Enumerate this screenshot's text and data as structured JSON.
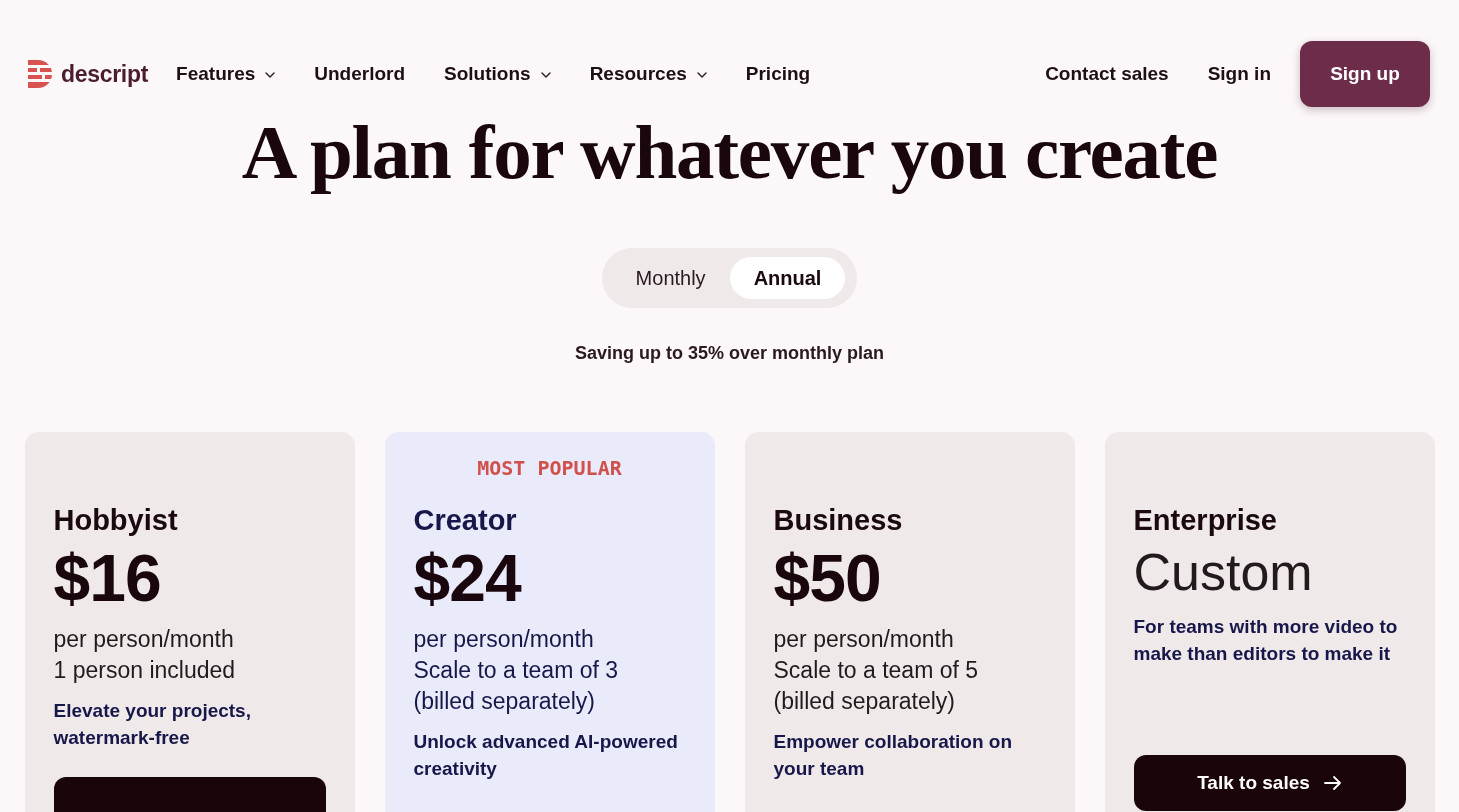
{
  "nav": {
    "logo": {
      "wordmark": "descript"
    },
    "links": [
      {
        "label": "Features",
        "has_menu": true
      },
      {
        "label": "Underlord",
        "has_menu": false
      },
      {
        "label": "Solutions",
        "has_menu": true
      },
      {
        "label": "Resources",
        "has_menu": true
      },
      {
        "label": "Pricing",
        "has_menu": false
      }
    ],
    "actions": [
      {
        "label": "Contact sales",
        "kind": "link"
      },
      {
        "label": "Sign in",
        "kind": "link"
      },
      {
        "label": "Sign up",
        "kind": "primary"
      }
    ]
  },
  "heading": "A plan for whatever you create",
  "billing_toggle": [
    {
      "label": "Monthly",
      "selected": false
    },
    {
      "label": "Annual",
      "selected": true
    }
  ],
  "savings_note": "Saving up to 35% over monthly plan",
  "plans": [
    {
      "kind": "amount",
      "name": "Hobbyist",
      "featured": false,
      "price": "$16",
      "details": [
        "per person/month",
        "1 person included"
      ],
      "description": "Elevate your projects, watermark-free",
      "button": {
        "kind": "blank"
      }
    },
    {
      "kind": "amount",
      "badge": "MOST POPULAR",
      "name": "Creator",
      "featured": true,
      "price": "$24",
      "details": [
        "per person/month",
        "Scale to a team of 3",
        "(billed separately)"
      ],
      "description": "Unlock advanced AI-powered creativity"
    },
    {
      "kind": "amount",
      "name": "Business",
      "featured": false,
      "price": "$50",
      "details": [
        "per person/month",
        "Scale to a team of 5",
        "(billed separately)"
      ],
      "description": "Empower collaboration on your team"
    },
    {
      "kind": "custom",
      "name": "Enterprise",
      "featured": false,
      "price": "Custom",
      "description": "For teams with more video to make than editors to make it",
      "button": {
        "kind": "labelled",
        "label": "Talk to sales"
      }
    }
  ]
}
